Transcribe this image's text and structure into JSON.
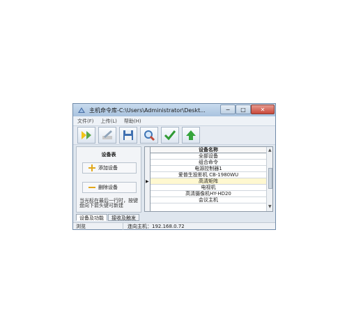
{
  "window": {
    "title": "主机命令库-C:\\Users\\Administrator\\Deskt...",
    "btn_min": "−",
    "btn_max": "□",
    "btn_close": "✕"
  },
  "menu": [
    "文件(F)",
    "上传(L)",
    "帮助(H)"
  ],
  "toolbar": {
    "buttons": [
      "open-icon",
      "edit-icon",
      "save-icon",
      "search-icon",
      "check-icon",
      "upload-icon"
    ]
  },
  "left_panel": {
    "title": "设备表",
    "add_label": "添加设备",
    "delete_label": "删除设备",
    "hint": "当光标在最后一行时，按键盘向下箭头键可新建"
  },
  "grid": {
    "header": "设备名称",
    "rows": [
      "全部设备",
      "组合命令",
      "电源控制器1",
      "爱普生投影机 CB-1980WU",
      "高清矩阵",
      "电视机",
      "高清摄像机HY-HD20",
      "会议主机"
    ],
    "selected_index": 4
  },
  "tabs": [
    "设备及功能",
    "接收及触发"
  ],
  "status": {
    "left": "浏览",
    "right": "连向主机：192.168.0.72"
  },
  "colors": {
    "title_gradient": "#a9c3df",
    "close_button": "#c9483a",
    "selected_row": "#fff8d0"
  }
}
